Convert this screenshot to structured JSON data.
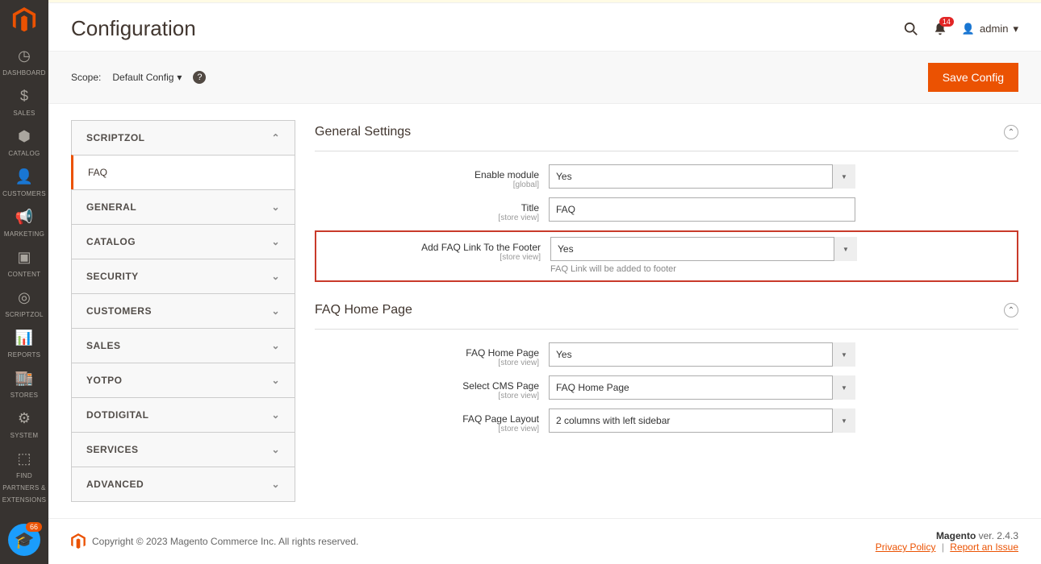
{
  "page": {
    "title": "Configuration"
  },
  "header": {
    "notification_count": "14",
    "admin_label": "admin"
  },
  "nav": [
    {
      "icon": "dashboard",
      "label": "DASHBOARD"
    },
    {
      "icon": "sales",
      "label": "SALES"
    },
    {
      "icon": "catalog",
      "label": "CATALOG"
    },
    {
      "icon": "customers",
      "label": "CUSTOMERS"
    },
    {
      "icon": "marketing",
      "label": "MARKETING"
    },
    {
      "icon": "content",
      "label": "CONTENT"
    },
    {
      "icon": "scriptzol",
      "label": "SCRIPTZOL"
    },
    {
      "icon": "reports",
      "label": "REPORTS"
    },
    {
      "icon": "stores",
      "label": "STORES"
    },
    {
      "icon": "system",
      "label": "SYSTEM"
    },
    {
      "icon": "partners",
      "label": "FIND PARTNERS & EXTENSIONS"
    }
  ],
  "help_badge": "66",
  "scope": {
    "label": "Scope:",
    "value": "Default Config"
  },
  "save_button": "Save Config",
  "tabs": {
    "active_header": "SCRIPTZOL",
    "active_link": "FAQ",
    "collapsed": [
      "GENERAL",
      "CATALOG",
      "SECURITY",
      "CUSTOMERS",
      "SALES",
      "YOTPO",
      "DOTDIGITAL",
      "SERVICES",
      "ADVANCED"
    ]
  },
  "sections": {
    "general": {
      "title": "General Settings",
      "fields": {
        "enable": {
          "label": "Enable module",
          "scope": "[global]",
          "value": "Yes"
        },
        "title": {
          "label": "Title",
          "scope": "[store view]",
          "value": "FAQ"
        },
        "footer_link": {
          "label": "Add FAQ Link To the Footer",
          "scope": "[store view]",
          "value": "Yes",
          "note": "FAQ Link will be added to footer"
        }
      }
    },
    "homepage": {
      "title": "FAQ Home Page",
      "fields": {
        "home": {
          "label": "FAQ Home Page",
          "scope": "[store view]",
          "value": "Yes"
        },
        "cms": {
          "label": "Select CMS Page",
          "scope": "[store view]",
          "value": "FAQ Home Page"
        },
        "layout": {
          "label": "FAQ Page Layout",
          "scope": "[store view]",
          "value": "2 columns with left sidebar"
        }
      }
    }
  },
  "footer": {
    "copyright": "Copyright © 2023 Magento Commerce Inc. All rights reserved.",
    "product": "Magento",
    "version": "ver. 2.4.3",
    "privacy": "Privacy Policy",
    "report": "Report an Issue"
  }
}
